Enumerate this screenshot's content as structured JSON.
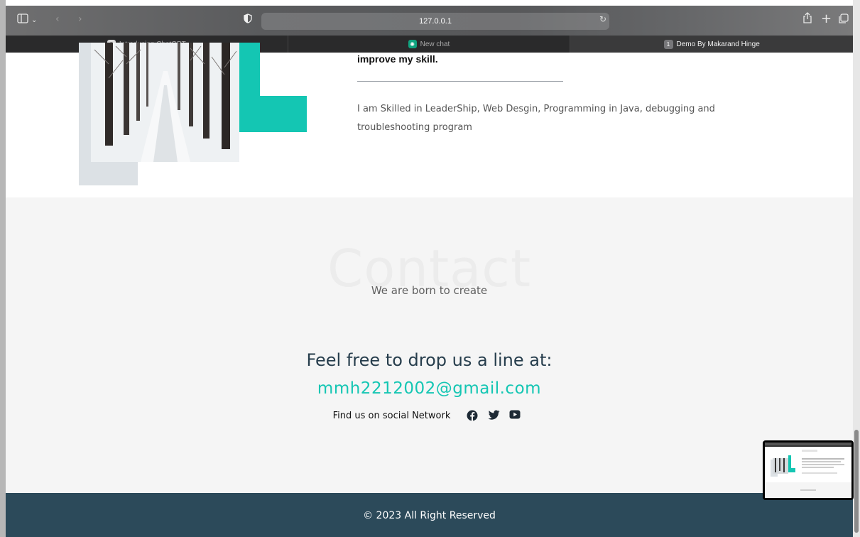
{
  "browser": {
    "address": "127.0.0.1",
    "tabs": [
      {
        "label": "Introducing ChatGPT",
        "active": false
      },
      {
        "label": "New chat",
        "active": false
      },
      {
        "label": "Demo By Makarand Hinge",
        "active": true,
        "badge": "1"
      }
    ]
  },
  "about": {
    "heading_partial": "improve my skill.",
    "text": "I am Skilled in LeaderShip, Web Desgin, Programming in Java, debugging and troubleshooting program"
  },
  "contact": {
    "ghost_title": "Contact",
    "subtitle": "We are born to create",
    "drop_line": "Feel free to drop us a line at:",
    "email": "mmh2212002@gmail.com",
    "social_label": "Find us on social Network"
  },
  "footer": {
    "text": "© 2023 All Right Reserved"
  },
  "colors": {
    "accent": "#14c6b3",
    "footer_bg": "#2c4a5a",
    "contact_bg": "#f5f5f5"
  },
  "icons": [
    "sidebar-icon",
    "chevron-down-icon",
    "back-icon",
    "forward-icon",
    "shield-icon",
    "reload-icon",
    "share-icon",
    "plus-icon",
    "tabs-overview-icon",
    "facebook-icon",
    "twitter-icon",
    "youtube-icon"
  ]
}
